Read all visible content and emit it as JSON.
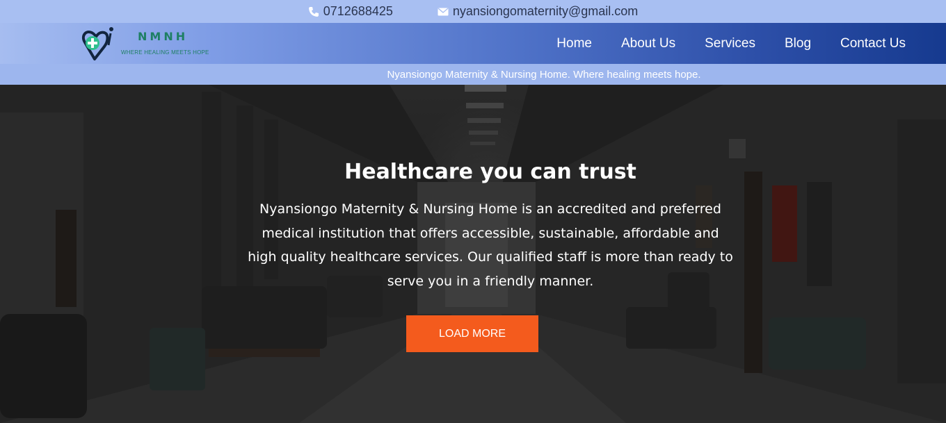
{
  "topbar": {
    "phone_icon": "phone-icon",
    "phone": "0712688425",
    "email_icon": "envelope-icon",
    "email": "nyansiongomaternity@gmail.com"
  },
  "logo": {
    "icon": "heart-medical-cross-logo",
    "title": "NMNH",
    "tagline": "WHERE HEALING MEETS HOPE"
  },
  "nav": {
    "items": [
      "Home",
      "About Us",
      "Services",
      "Blog",
      "Contact Us"
    ]
  },
  "subbar": {
    "text": "Nyansiongo Maternity & Nursing Home. Where healing meets hope."
  },
  "hero": {
    "title": "Healthcare you can trust",
    "text": "Nyansiongo Maternity & Nursing Home is an accredited and preferred medical institution that offers accessible, sustainable, affordable and high quality healthcare services. Our qualified staff is more than ready to serve you in a friendly manner.",
    "button": "LOAD MORE",
    "background": "hospital-corridor-photo"
  },
  "colors": {
    "topbar": "#a8bff2",
    "nav_gradient_end": "#163a8f",
    "accent": "#f45b1d",
    "logo_green": "#1e7f63"
  }
}
